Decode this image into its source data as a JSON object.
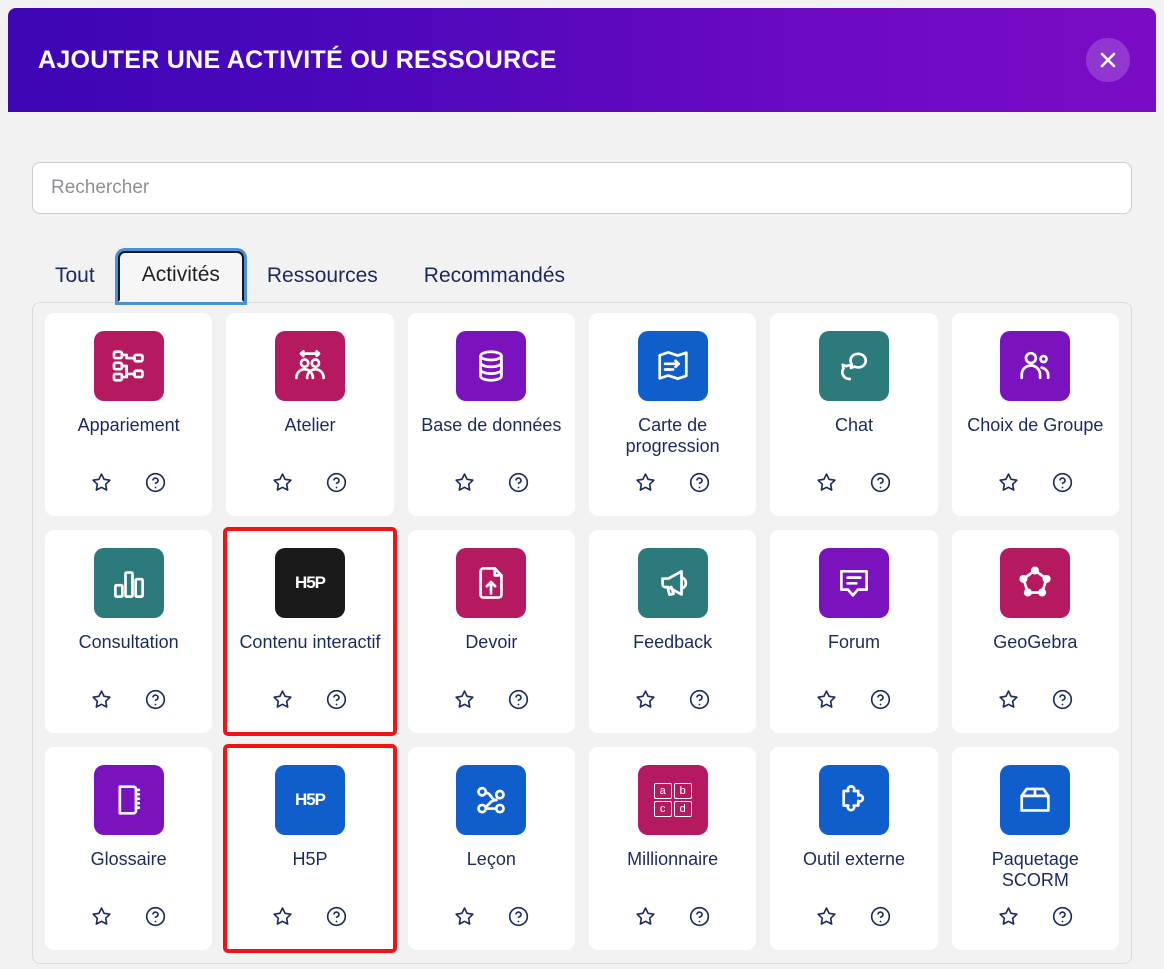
{
  "header": {
    "title": "AJOUTER UNE ACTIVITÉ OU RESSOURCE",
    "close_label": "×",
    "gradient_start": "#3d06b5",
    "gradient_end": "#7b0cc6"
  },
  "search": {
    "placeholder": "Rechercher",
    "value": ""
  },
  "tabs": [
    {
      "label": "Tout",
      "active": false
    },
    {
      "label": "Activités",
      "active": true
    },
    {
      "label": "Ressources",
      "active": false
    },
    {
      "label": "Recommandés",
      "active": false
    }
  ],
  "cards": [
    {
      "label": "Appariement",
      "icon": "nodes-hierarchy-icon",
      "color": "#b5195f",
      "highlight": false
    },
    {
      "label": "Atelier",
      "icon": "workshop-people-icon",
      "color": "#b5195f",
      "highlight": false
    },
    {
      "label": "Base de données",
      "icon": "database-icon",
      "color": "#7a12be",
      "highlight": false
    },
    {
      "label": "Carte de progression",
      "icon": "map-flag-icon",
      "color": "#0f5ecc",
      "highlight": false
    },
    {
      "label": "Chat",
      "icon": "chat-bubbles-icon",
      "color": "#2d7a7d",
      "highlight": false
    },
    {
      "label": "Choix de Groupe",
      "icon": "group-choice-icon",
      "color": "#7a12be",
      "highlight": false
    },
    {
      "label": "Consultation",
      "icon": "bar-chart-icon",
      "color": "#2d7a7d",
      "highlight": false
    },
    {
      "label": "Contenu interactif",
      "icon": "h5p-black-icon",
      "color": "#1a1a1a",
      "highlight": true
    },
    {
      "label": "Devoir",
      "icon": "assignment-upload-icon",
      "color": "#b5195f",
      "highlight": false
    },
    {
      "label": "Feedback",
      "icon": "megaphone-icon",
      "color": "#2d7a7d",
      "highlight": false
    },
    {
      "label": "Forum",
      "icon": "forum-speech-icon",
      "color": "#7a12be",
      "highlight": false
    },
    {
      "label": "GeoGebra",
      "icon": "pentagon-nodes-icon",
      "color": "#b5195f",
      "highlight": false
    },
    {
      "label": "Glossaire",
      "icon": "book-icon",
      "color": "#7a12be",
      "highlight": false
    },
    {
      "label": "H5P",
      "icon": "h5p-blue-icon",
      "color": "#0f5ecc",
      "highlight": true
    },
    {
      "label": "Leçon",
      "icon": "lesson-path-icon",
      "color": "#0f5ecc",
      "highlight": false
    },
    {
      "label": "Millionnaire",
      "icon": "abcd-grid-icon",
      "color": "#b5195f",
      "highlight": false
    },
    {
      "label": "Outil externe",
      "icon": "puzzle-piece-icon",
      "color": "#0f5ecc",
      "highlight": false
    },
    {
      "label": "Paquetage SCORM",
      "icon": "scorm-box-icon",
      "color": "#0f5ecc",
      "highlight": false
    }
  ],
  "card_actions": {
    "favourite_icon": "star-outline-icon",
    "help_icon": "question-circle-icon"
  },
  "colors": {
    "highlight_border": "#f01414",
    "tab_focus_ring": "#4a90d9",
    "body_bg": "#f2f2f2",
    "card_bg": "#ffffff",
    "label_text": "#1b2a5e"
  }
}
